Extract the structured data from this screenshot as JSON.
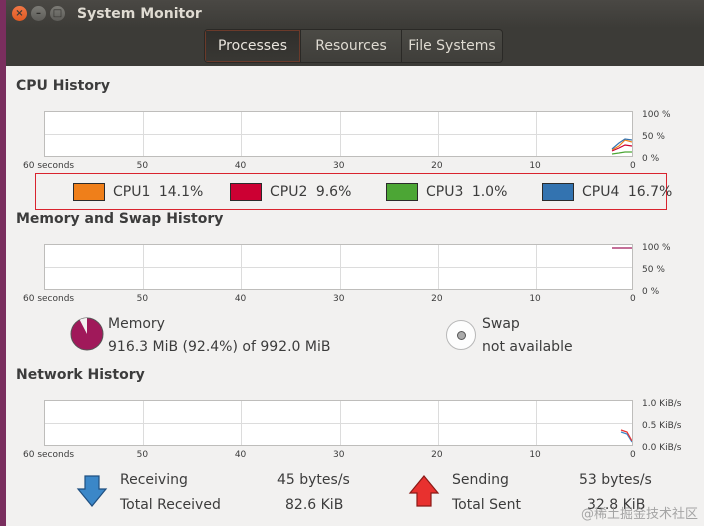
{
  "window": {
    "title": "System Monitor"
  },
  "tabs": [
    {
      "label": "Processes",
      "active": true
    },
    {
      "label": "Resources",
      "active": false
    },
    {
      "label": "File Systems",
      "active": false
    }
  ],
  "x_ticks": [
    "60 seconds",
    "50",
    "40",
    "30",
    "20",
    "10",
    "0"
  ],
  "cpu": {
    "title": "CPU History",
    "y_ticks": [
      "100 %",
      "50 %",
      "0 %"
    ],
    "legend": [
      {
        "label": "CPU1",
        "value": "14.1%",
        "color": "#ef7f1a"
      },
      {
        "label": "CPU2",
        "value": "9.6%",
        "color": "#cc0033"
      },
      {
        "label": "CPU3",
        "value": "1.0%",
        "color": "#4ca635"
      },
      {
        "label": "CPU4",
        "value": "16.7%",
        "color": "#3373b0"
      }
    ]
  },
  "memory": {
    "title": "Memory and Swap History",
    "y_ticks": [
      "100 %",
      "50 %",
      "0 %"
    ],
    "memory_label": "Memory",
    "memory_value": "916.3 MiB (92.4%) of 992.0 MiB",
    "memory_fraction": 0.924,
    "memory_color": "#a0195a",
    "swap_label": "Swap",
    "swap_value": "not available"
  },
  "network": {
    "title": "Network History",
    "y_ticks": [
      "1.0 KiB/s",
      "0.5 KiB/s",
      "0.0 KiB/s"
    ],
    "receiving_label": "Receiving",
    "receiving_value": "45 bytes/s",
    "total_received_label": "Total Received",
    "total_received_value": "82.6 KiB",
    "sending_label": "Sending",
    "sending_value": "53 bytes/s",
    "total_sent_label": "Total Sent",
    "total_sent_value": "32.8 KiB",
    "receiving_color": "#3b87c8",
    "sending_color": "#e8312f"
  },
  "watermark": "@稀土掘金技术社区"
}
